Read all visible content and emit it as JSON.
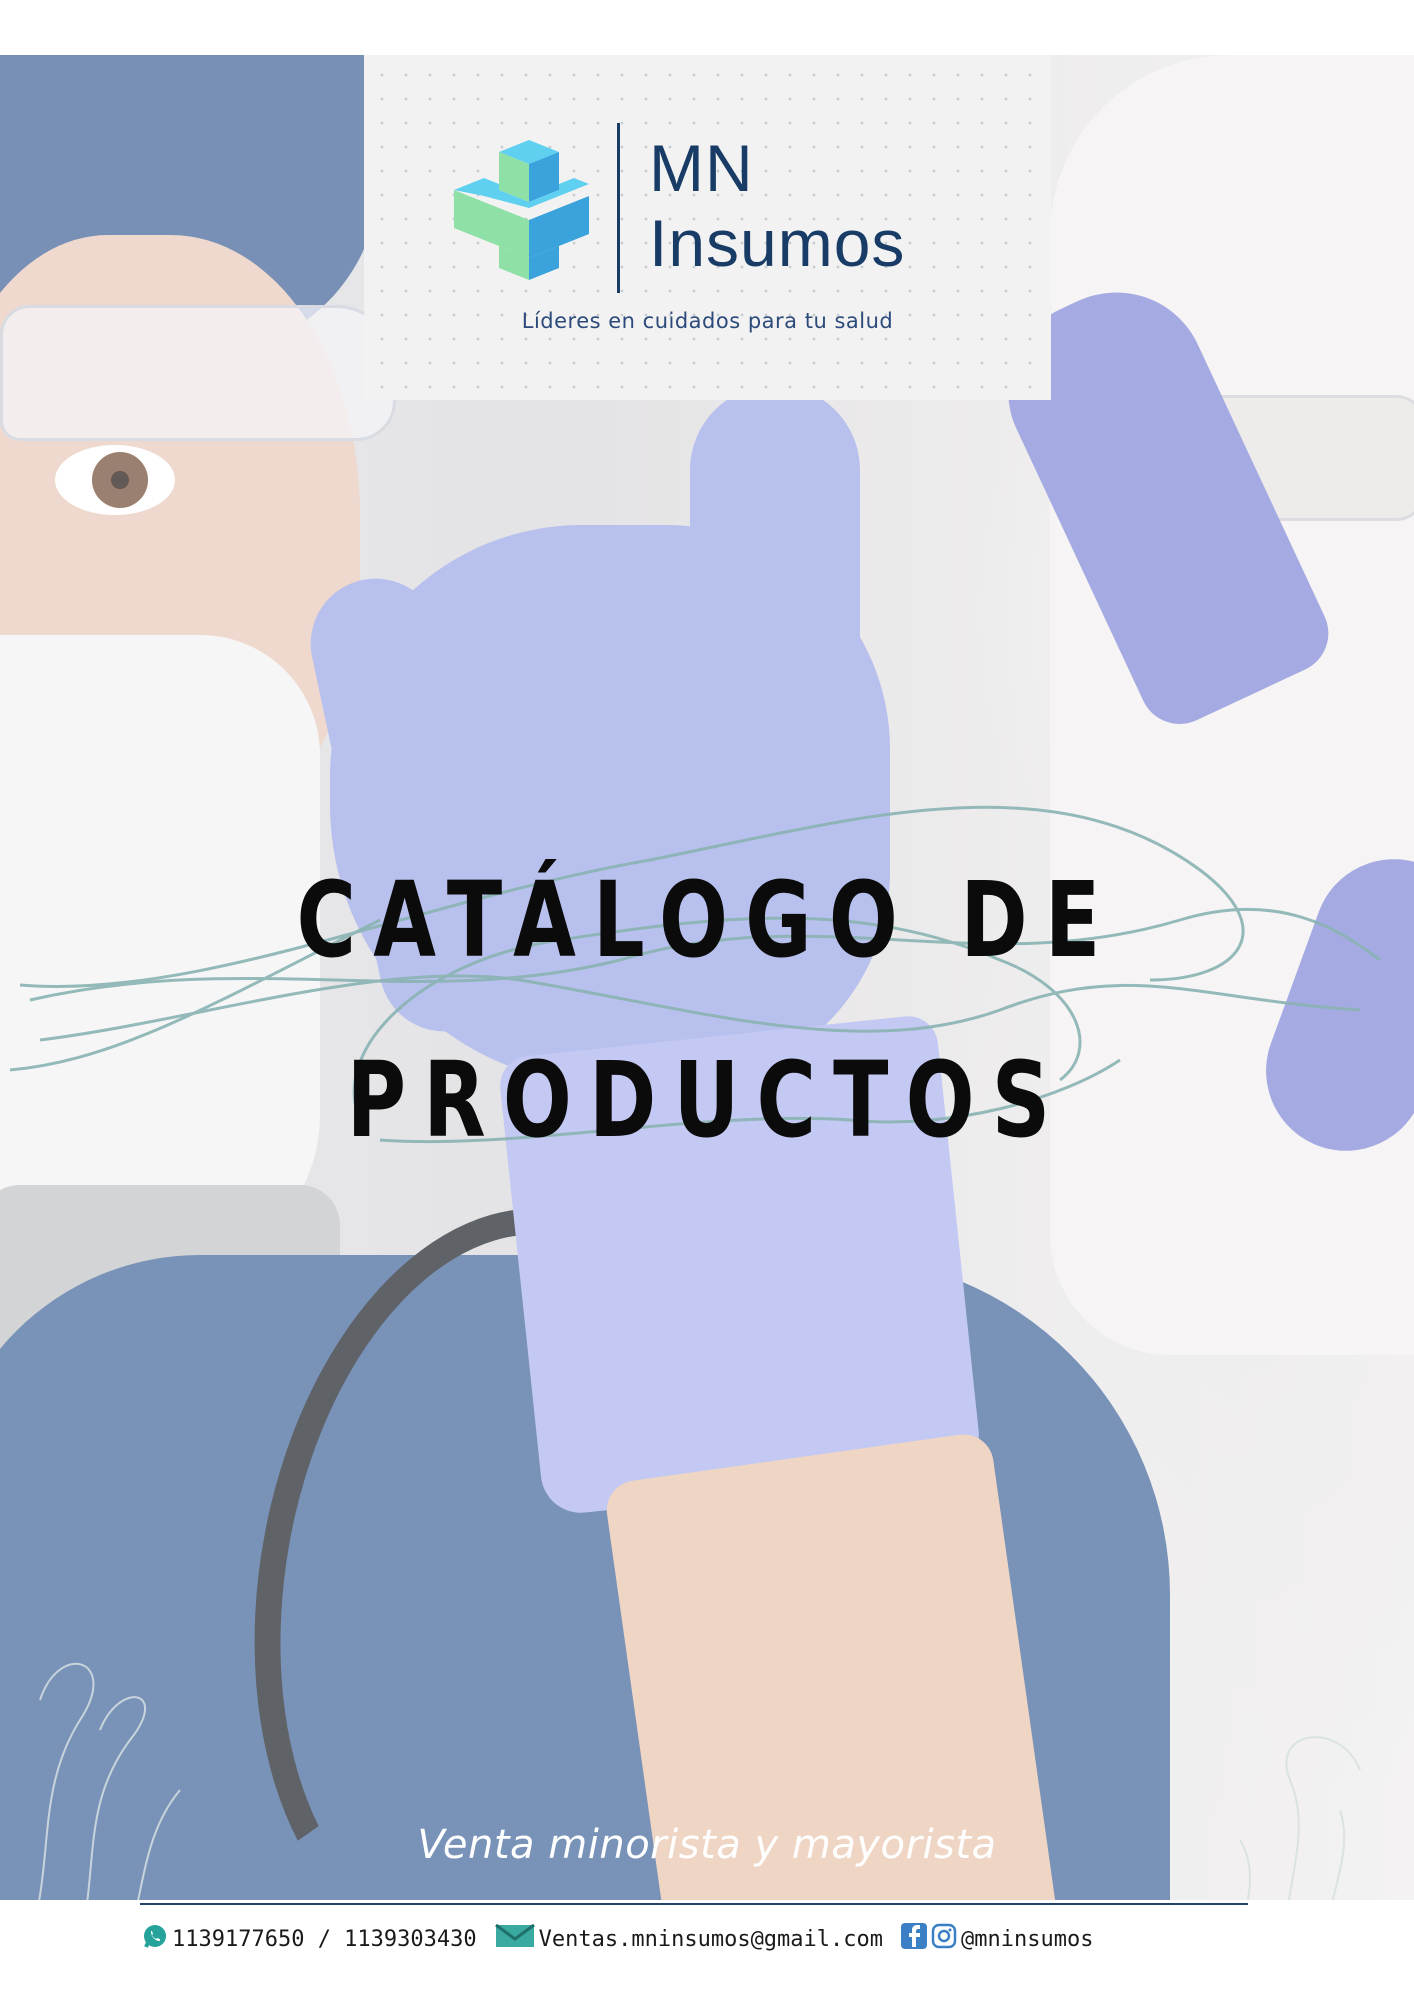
{
  "brand": {
    "line1": "MN",
    "line2": "Insumos",
    "tagline": "Líderes en cuidados para tu salud",
    "logo_icon": "medical-cross-icon",
    "colors": {
      "navy": "#183c66",
      "cross_blue": "#3aa3dc",
      "cross_green": "#8fe0a6"
    }
  },
  "title": {
    "line1": "CATÁLOGO DE",
    "line2": "PRODUCTOS"
  },
  "subtitle": "Venta minorista y mayorista",
  "contact": {
    "phones": "1139177650 / 1139303430",
    "email": "Ventas.mninsumos@gmail.com",
    "social": "@mninsumos",
    "icons": [
      "whatsapp-icon",
      "mail-icon",
      "facebook-icon",
      "instagram-icon"
    ]
  }
}
